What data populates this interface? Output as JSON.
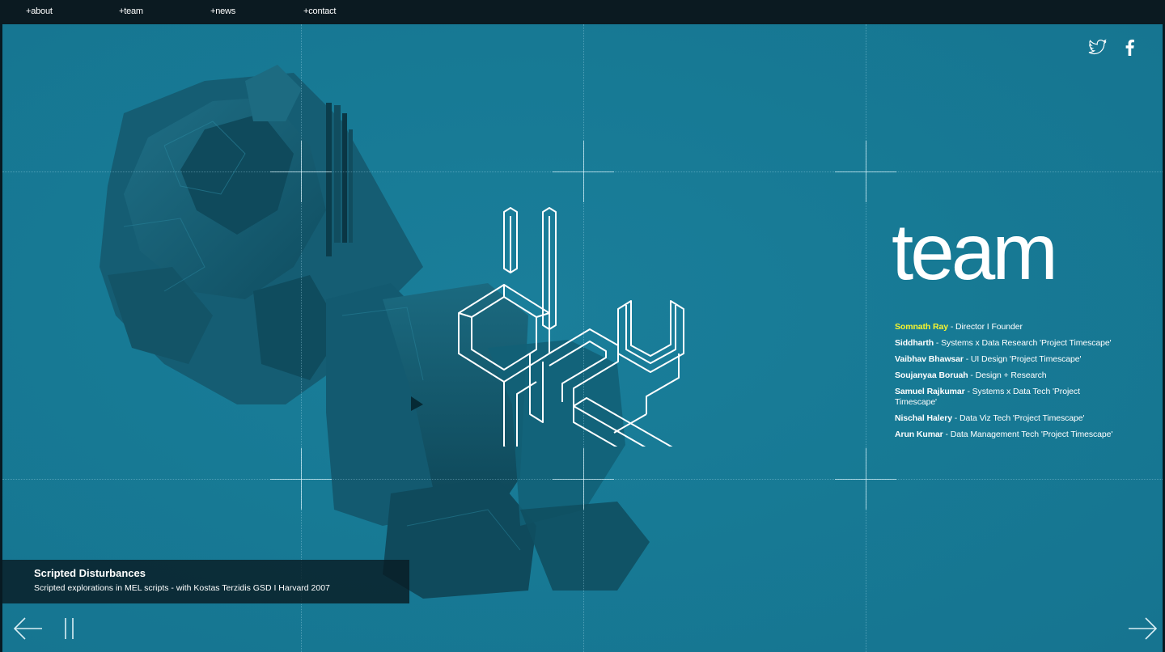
{
  "nav": {
    "items": [
      "+about",
      "+team",
      "+news",
      "+contact"
    ]
  },
  "social": {
    "twitter_icon": "twitter-icon",
    "facebook_icon": "facebook-icon"
  },
  "logo": {
    "icon": "ray-monogram-logo-icon"
  },
  "team": {
    "heading": "team",
    "members": [
      {
        "name": "Somnath Ray",
        "role": " - Director I Founder"
      },
      {
        "name": "Siddharth",
        "role": " - Systems x Data Research 'Project Timescape'"
      },
      {
        "name": "Vaibhav Bhawsar",
        "role": " - UI Design 'Project Timescape'"
      },
      {
        "name": "Soujanyaa Boruah",
        "role": " - Design + Research"
      },
      {
        "name": "Samuel Rajkumar",
        "role": " - Systems x Data Tech 'Project Timescape'"
      },
      {
        "name": "Nischal Halery",
        "role": " - Data Viz Tech 'Project Timescape'"
      },
      {
        "name": "Arun Kumar",
        "role": " - Data Management Tech 'Project Timescape'"
      }
    ]
  },
  "caption": {
    "title": "Scripted Disturbances",
    "subtitle": "Scripted explorations in MEL scripts - with Kostas Terzidis GSD I Harvard 2007"
  },
  "controls": {
    "prev_icon": "arrow-left-icon",
    "pause_icon": "pause-icon",
    "next_icon": "arrow-right-icon"
  },
  "colors": {
    "background": "#177a95",
    "nav_bar": "#0b1a21",
    "highlight": "#f7f42e"
  }
}
